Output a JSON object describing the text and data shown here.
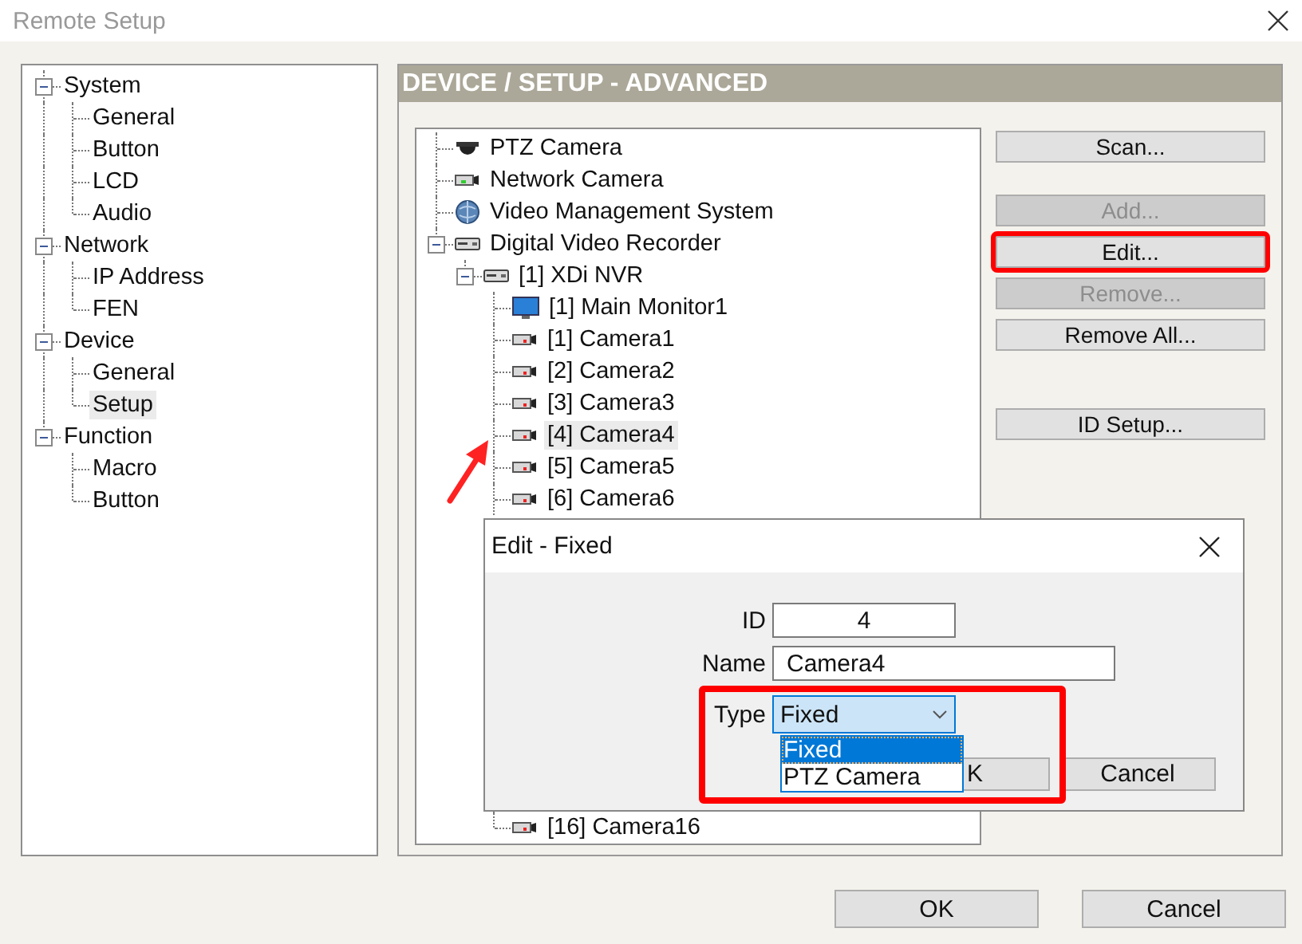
{
  "window": {
    "title": "Remote Setup"
  },
  "nav_tree": [
    {
      "label": "System",
      "expanded": true,
      "selected": false,
      "children": [
        {
          "label": "General",
          "selected": false
        },
        {
          "label": "Button",
          "selected": false
        },
        {
          "label": "LCD",
          "selected": false
        },
        {
          "label": "Audio",
          "selected": false
        }
      ]
    },
    {
      "label": "Network",
      "expanded": true,
      "selected": false,
      "children": [
        {
          "label": "IP Address",
          "selected": false
        },
        {
          "label": "FEN",
          "selected": false
        }
      ]
    },
    {
      "label": "Device",
      "expanded": true,
      "selected": false,
      "children": [
        {
          "label": "General",
          "selected": false
        },
        {
          "label": "Setup",
          "selected": true
        }
      ]
    },
    {
      "label": "Function",
      "expanded": true,
      "selected": false,
      "children": [
        {
          "label": "Macro",
          "selected": false
        },
        {
          "label": "Button",
          "selected": false
        }
      ]
    }
  ],
  "panel": {
    "title": "DEVICE / SETUP - ADVANCED"
  },
  "device_tree": [
    {
      "label": "PTZ Camera",
      "kind": "ptz",
      "selected": false
    },
    {
      "label": "Network Camera",
      "kind": "network-camera",
      "selected": false
    },
    {
      "label": "Video Management System",
      "kind": "vms",
      "selected": false
    },
    {
      "label": "Digital Video Recorder",
      "kind": "recorder",
      "selected": false,
      "expanded": true,
      "children": [
        {
          "label": "[1] XDi NVR",
          "kind": "recorder",
          "selected": false,
          "expanded": true,
          "children": [
            {
              "label": "[1] Main Monitor1",
              "kind": "monitor",
              "selected": false
            },
            {
              "label": "[1] Camera1",
              "kind": "camera",
              "selected": false
            },
            {
              "label": "[2] Camera2",
              "kind": "camera",
              "selected": false
            },
            {
              "label": "[3] Camera3",
              "kind": "camera",
              "selected": false
            },
            {
              "label": "[4] Camera4",
              "kind": "camera",
              "selected": true
            },
            {
              "label": "[5] Camera5",
              "kind": "camera",
              "selected": false
            },
            {
              "label": "[6] Camera6",
              "kind": "camera",
              "selected": false
            },
            {
              "label": "[16] Camera16",
              "kind": "camera",
              "selected": false
            }
          ]
        }
      ]
    }
  ],
  "side_buttons": [
    {
      "label": "Scan...",
      "disabled": false,
      "highlighted": false
    },
    {
      "label": "Add...",
      "disabled": true,
      "highlighted": false
    },
    {
      "label": "Edit...",
      "disabled": false,
      "highlighted": true
    },
    {
      "label": "Remove...",
      "disabled": true,
      "highlighted": false
    },
    {
      "label": "Remove All...",
      "disabled": false,
      "highlighted": false
    },
    {
      "label": "ID Setup...",
      "disabled": false,
      "highlighted": false
    }
  ],
  "annotations": [
    {
      "kind": "arrow"
    }
  ],
  "dialog": {
    "title": "Edit - Fixed",
    "fields": [
      {
        "label": "ID",
        "value": "4",
        "kind": "number"
      },
      {
        "label": "Name",
        "value": "Camera4",
        "kind": "text"
      }
    ],
    "type": {
      "label": "Type",
      "value": "Fixed",
      "highlighted": true,
      "options": [
        {
          "label": "Fixed",
          "selected": true
        },
        {
          "label": "PTZ Camera",
          "selected": false
        }
      ]
    },
    "buttons": [
      "K",
      "Cancel"
    ]
  },
  "footer_buttons": [
    "OK",
    "Cancel"
  ]
}
